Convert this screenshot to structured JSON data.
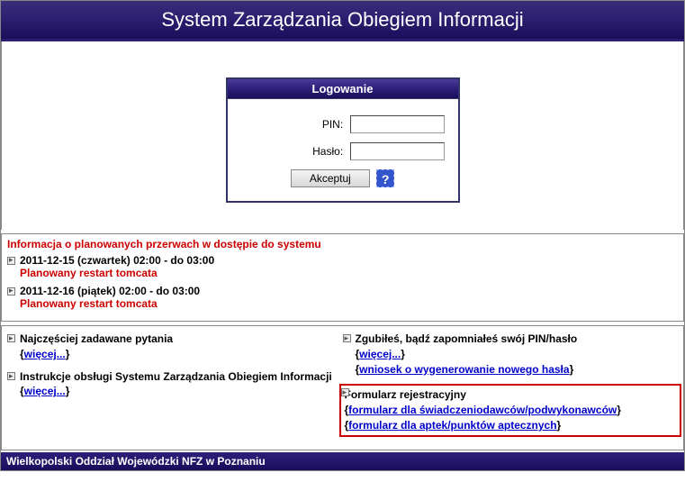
{
  "header": {
    "title": "System Zarządzania Obiegiem Informacji"
  },
  "login": {
    "panel_title": "Logowanie",
    "pin_label": "PIN:",
    "password_label": "Hasło:",
    "submit_label": "Akceptuj",
    "help_symbol": "?"
  },
  "outage_section": {
    "title": "Informacja o planowanych przerwach w dostępie do systemu",
    "items": [
      {
        "date": "2011-12-15 (czwartek) 02:00 - do 03:00",
        "desc": "Planowany restart tomcata"
      },
      {
        "date": "2011-12-16 (piątek) 02:00 - do 03:00",
        "desc": "Planowany restart tomcata"
      }
    ]
  },
  "links": {
    "left": [
      {
        "title": "Najczęściej zadawane pytania",
        "more": "więcej..."
      },
      {
        "title": "Instrukcje obsługi Systemu Zarządzania Obiegiem Informacji",
        "more": "więcej..."
      }
    ],
    "right": {
      "forgot": {
        "title": "Zgubiłeś, bądź zapomniałeś swój PIN/hasło",
        "more": "więcej...",
        "request": "wniosek o wygenerowanie nowego hasła"
      },
      "register": {
        "title": "Formularz rejestracyjny",
        "link1": "formularz dla świadczeniodawców/podwykonawców",
        "link2": "formularz dla aptek/punktów aptecznych"
      }
    }
  },
  "footer": {
    "text": "Wielkopolski Oddział Wojewódzki NFZ w Poznaniu"
  }
}
